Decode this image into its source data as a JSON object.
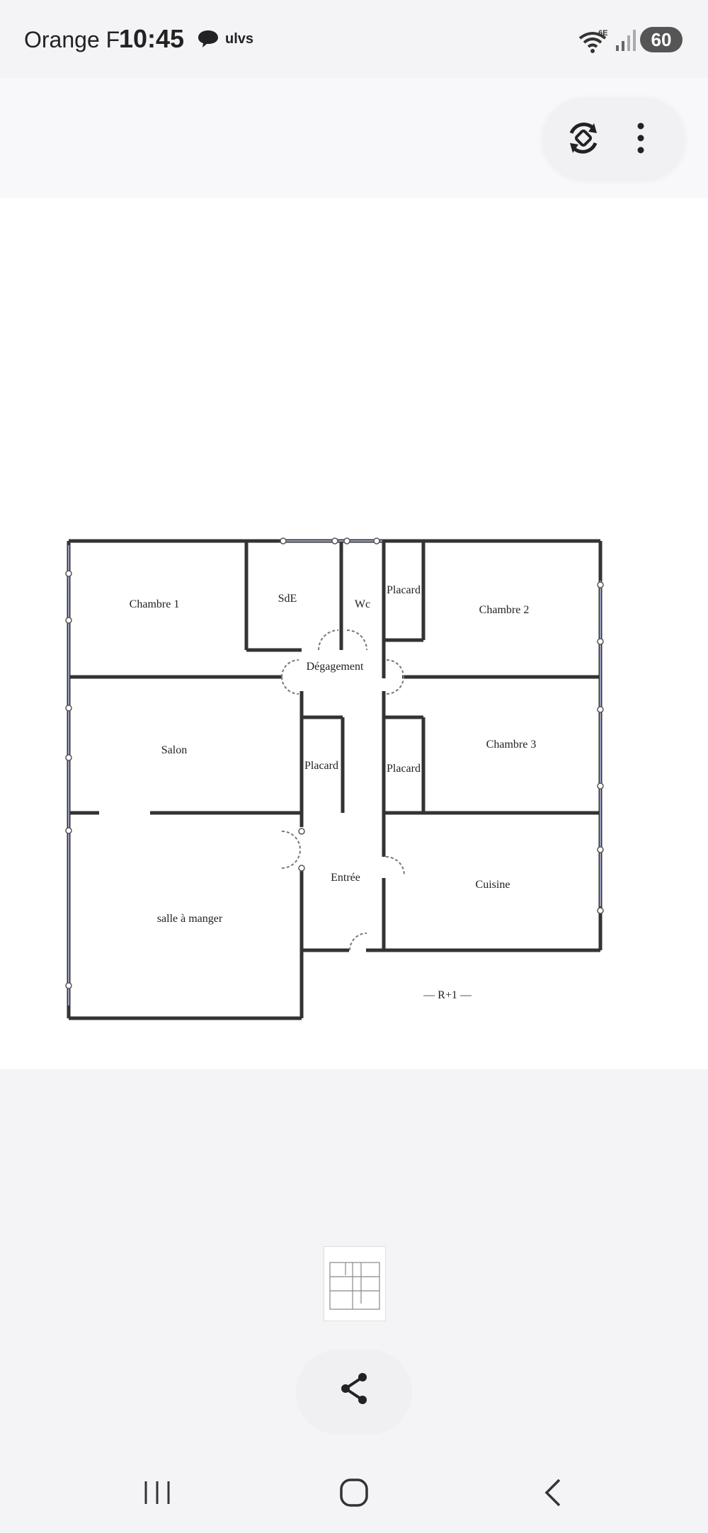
{
  "status_bar": {
    "carrier": "Orange F",
    "time": "10:45",
    "app_notification": "ulvs",
    "network": "6E",
    "battery": "60"
  },
  "toolbar": {
    "rotate_icon": "rotate-icon",
    "more_icon": "more-vertical-icon"
  },
  "floorplan": {
    "rooms": {
      "chambre1": "Chambre 1",
      "sde": "SdE",
      "wc": "Wc",
      "placard_top": "Placard",
      "chambre2": "Chambre 2",
      "degagement": "Dégagement",
      "salon": "Salon",
      "placard_left": "Placard",
      "placard_right": "Placard",
      "chambre3": "Chambre 3",
      "entree": "Entrée",
      "cuisine": "Cuisine",
      "salle_a_manger": "salle à manger"
    },
    "level": "— R+1 —"
  },
  "bottom": {
    "share_icon": "share-icon"
  },
  "navbar": {
    "recent_icon": "recent-apps-icon",
    "home_icon": "home-icon",
    "back_icon": "back-icon"
  }
}
